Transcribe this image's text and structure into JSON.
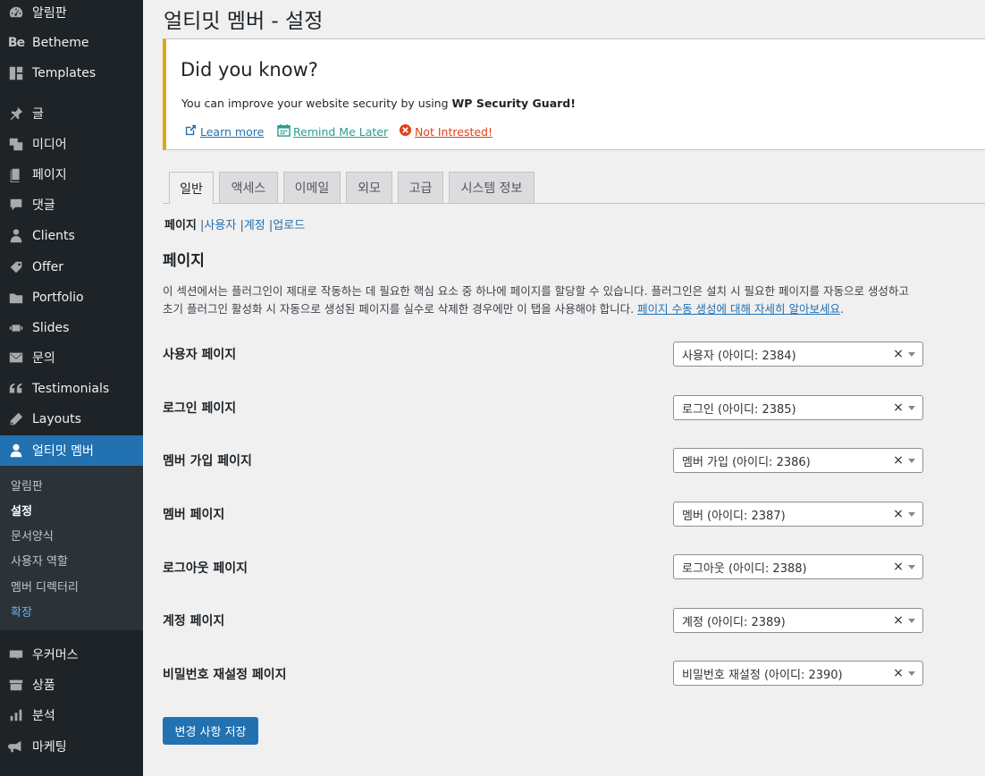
{
  "sidebar": {
    "items": [
      {
        "label": "알림판",
        "icon": "dashboard-icon"
      },
      {
        "label": "Betheme",
        "icon": "betheme-icon",
        "logo_text": "Be"
      },
      {
        "label": "Templates",
        "icon": "templates-icon"
      },
      {
        "label": "글",
        "icon": "pin-icon"
      },
      {
        "label": "미디어",
        "icon": "media-icon"
      },
      {
        "label": "페이지",
        "icon": "page-icon"
      },
      {
        "label": "댓글",
        "icon": "comment-icon"
      },
      {
        "label": "Clients",
        "icon": "clients-icon"
      },
      {
        "label": "Offer",
        "icon": "offer-icon"
      },
      {
        "label": "Portfolio",
        "icon": "portfolio-icon"
      },
      {
        "label": "Slides",
        "icon": "slides-icon"
      },
      {
        "label": "문의",
        "icon": "mail-icon"
      },
      {
        "label": "Testimonials",
        "icon": "quote-icon"
      },
      {
        "label": "Layouts",
        "icon": "layouts-icon"
      },
      {
        "label": "얼티밋 멤버",
        "icon": "user-icon"
      },
      {
        "label": "우커머스",
        "icon": "woo-icon",
        "logo_text": "woo"
      },
      {
        "label": "상품",
        "icon": "products-icon"
      },
      {
        "label": "분석",
        "icon": "analytics-icon"
      },
      {
        "label": "마케팅",
        "icon": "megaphone-icon"
      }
    ],
    "submenu": [
      "알림판",
      "설정",
      "문서양식",
      "사용자 역할",
      "멤버 디렉터리",
      "확장"
    ]
  },
  "page_title": "얼티밋 멤버 - 설정",
  "notice": {
    "heading": "Did you know?",
    "message_prefix": "You can improve your website security by using ",
    "message_bold": "WP Security Guard!",
    "learn_more": "Learn more",
    "remind_later": "Remind Me Later",
    "not_interested": "Not Intrested!"
  },
  "tabs": [
    "일반",
    "액세스",
    "이메일",
    "외모",
    "고급",
    "시스템 정보"
  ],
  "subsub": {
    "current": "페이지",
    "links": [
      "사용자",
      "계정",
      "업로드"
    ],
    "separator": "|"
  },
  "section": {
    "title": "페이지",
    "desc_line1": "이 섹션에서는 플러그인이 제대로 작동하는 데 필요한 핵심 요소 중 하나에 페이지를 할당할 수 있습니다. 플러그인은 설치 시 필요한 페이지를 자동으로 생성하고",
    "desc_line2": "초기 플러그인 활성화 시 자동으로 생성된 페이지를 실수로 삭제한 경우에만 이 탭을 사용해야 합니다. ",
    "desc_link": "페이지 수동 생성에 대해 자세히 알아보세요",
    "desc_end": "."
  },
  "rows": [
    {
      "label": "사용자 페이지",
      "value": "사용자 (아이디: 2384)"
    },
    {
      "label": "로그인 페이지",
      "value": "로그인 (아이디: 2385)"
    },
    {
      "label": "멤버 가입 페이지",
      "value": "멤버 가입 (아이디: 2386)"
    },
    {
      "label": "멤버 페이지",
      "value": "멤버 (아이디: 2387)"
    },
    {
      "label": "로그아웃 페이지",
      "value": "로그아웃 (아이디: 2388)"
    },
    {
      "label": "계정 페이지",
      "value": "계정 (아이디: 2389)"
    },
    {
      "label": "비밀번호 재설정 페이지",
      "value": "비밀번호 재설정 (아이디: 2390)"
    }
  ],
  "select_clear": "×",
  "save_button": "변경 사항 저장",
  "colors": {
    "sidebar_bg": "#1d2327",
    "accent": "#2271b1",
    "notice_border": "#dba617",
    "link_teal": "#2a9d8f",
    "link_red": "#e2401c"
  }
}
